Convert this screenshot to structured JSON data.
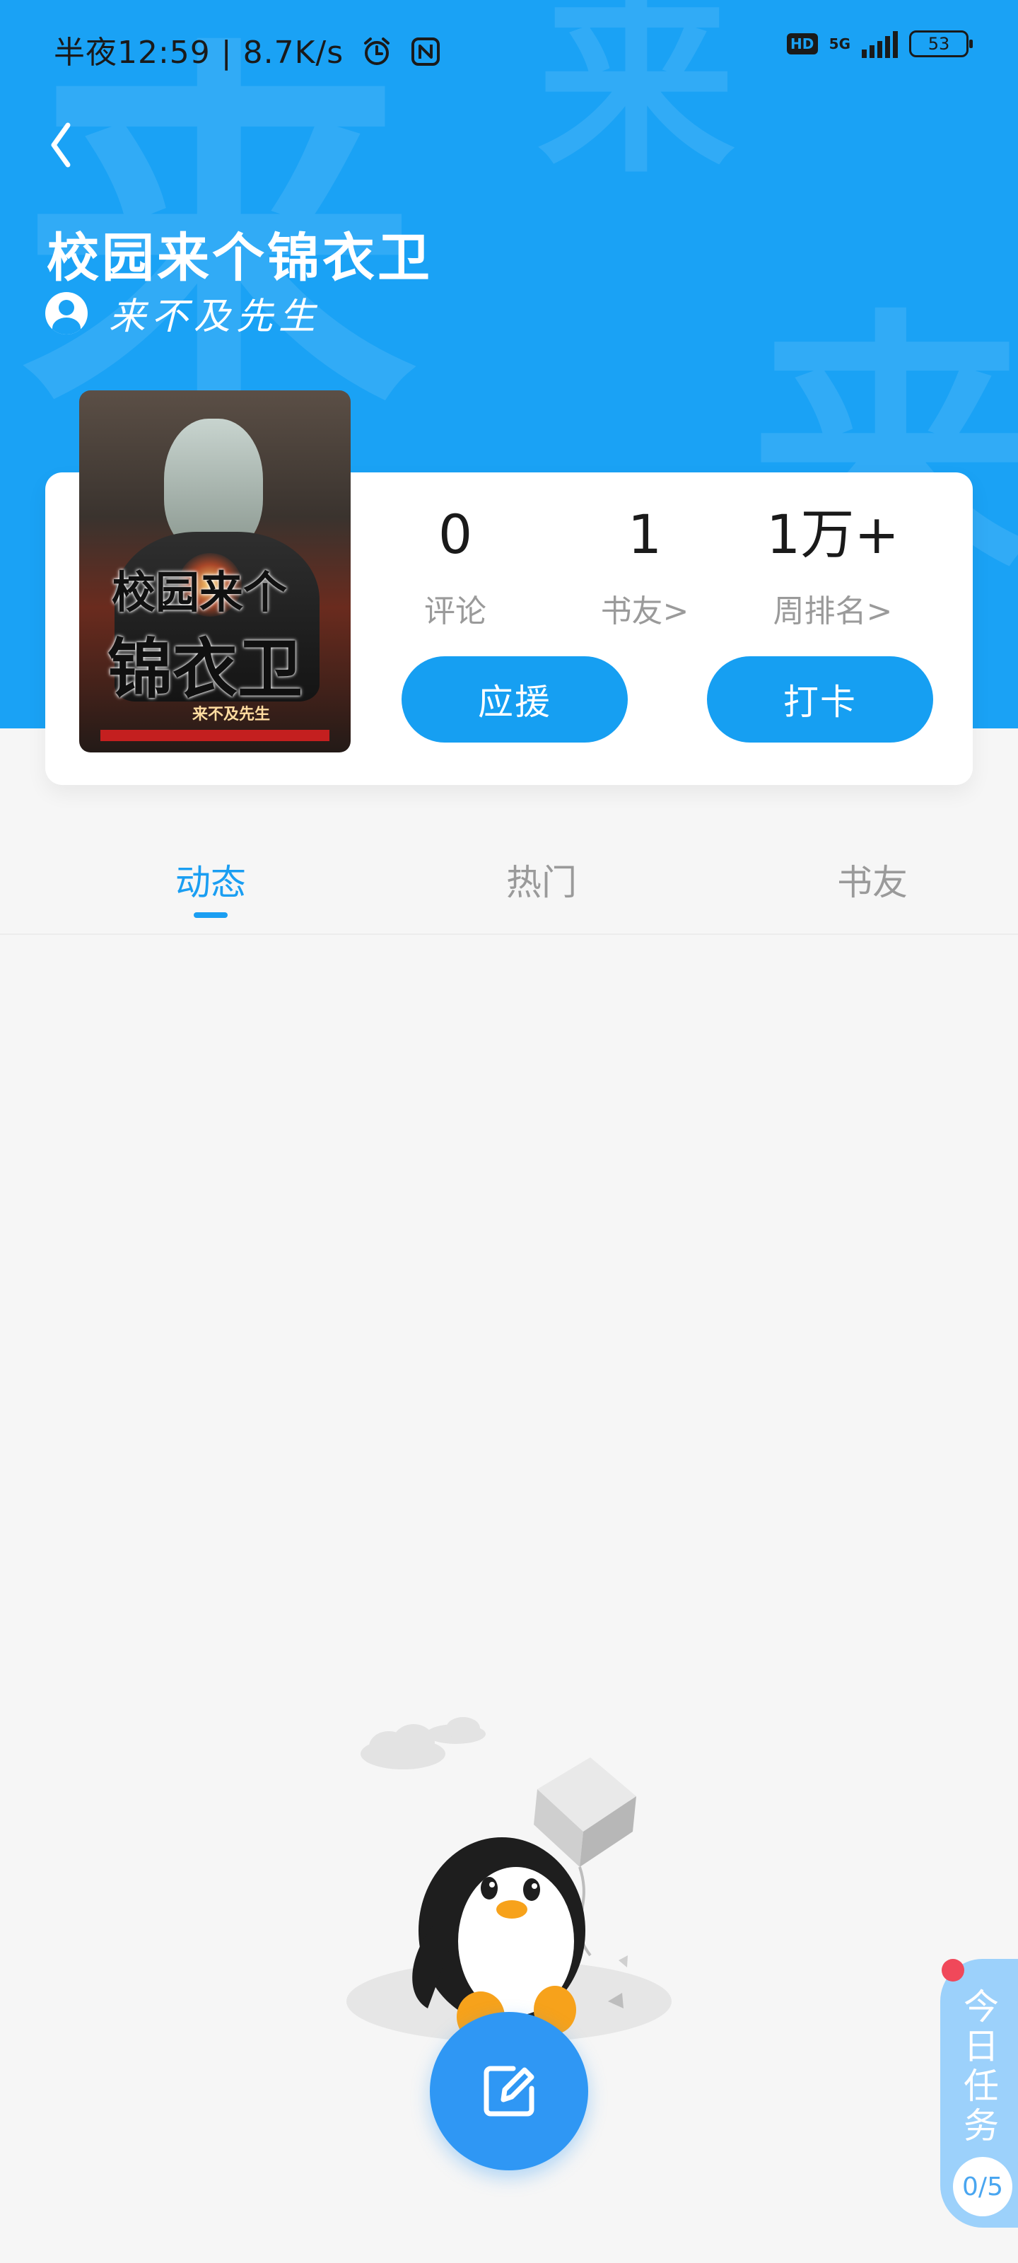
{
  "status_bar": {
    "time_text": "半夜12:59 | 8.7K/s",
    "hd_badge": "HD",
    "network": "5G",
    "battery": "53"
  },
  "header": {
    "title": "校园来个锦衣卫",
    "author": "来不及先生",
    "watermark_char": "来"
  },
  "book": {
    "cover_title_line1": "校园来个",
    "cover_title_line2": "锦衣卫",
    "cover_author": "来不及先生"
  },
  "stats": {
    "comments": {
      "value": "0",
      "label": "评论"
    },
    "friends": {
      "value": "1",
      "label": "书友>"
    },
    "rank": {
      "value": "1万+",
      "label": "周排名>"
    }
  },
  "buttons": {
    "support": "应援",
    "checkin": "打卡"
  },
  "tabs": [
    {
      "label": "动态"
    },
    {
      "label": "热门"
    },
    {
      "label": "书友"
    }
  ],
  "daily_task": {
    "label": "今日任务",
    "progress": "0/5"
  },
  "icons": {
    "back": "chevron-left-icon",
    "compose": "edit-icon",
    "alarm": "alarm-icon",
    "nfc": "nfc-icon"
  },
  "colors": {
    "primary": "#1aa2f5",
    "button": "#169ff2",
    "tab_active": "#1a9ef2",
    "badge_dot": "#f0485a"
  }
}
